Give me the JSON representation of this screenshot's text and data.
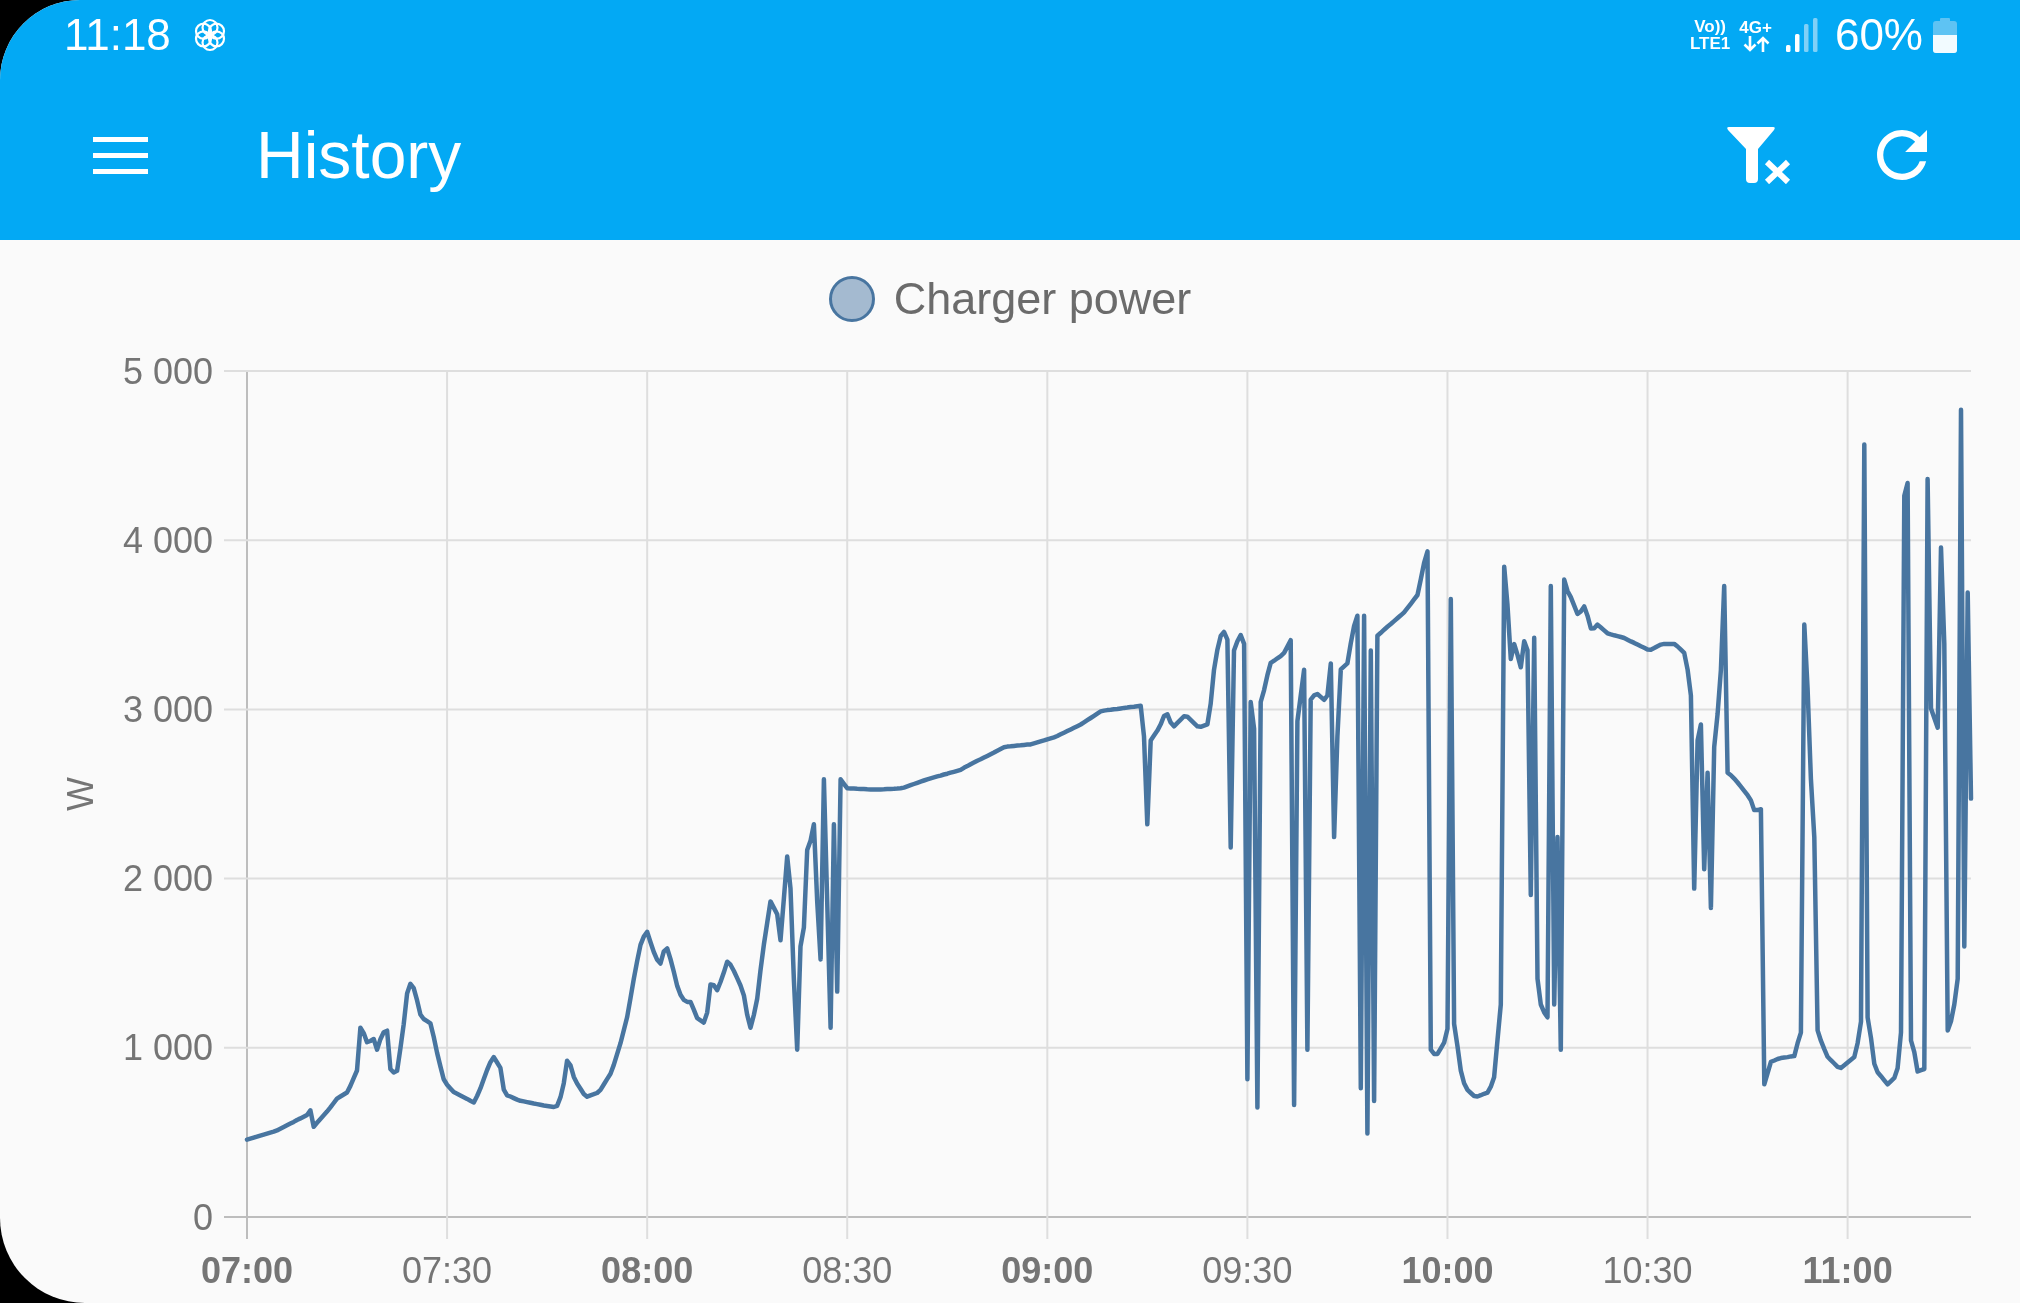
{
  "status_bar": {
    "time": "11:18",
    "volte": {
      "top": "Vo))",
      "bottom": "LTE1"
    },
    "network_type": "4G+",
    "battery_percent": "60%"
  },
  "app_bar": {
    "title": "History"
  },
  "chart": {
    "chart_data": {
      "type": "line",
      "ylabel": "W",
      "grid": true,
      "categories": [
        "07:00",
        null,
        null,
        null,
        null,
        null,
        null,
        null,
        null,
        null,
        null,
        null,
        null,
        null,
        null,
        null,
        null,
        null,
        null,
        null,
        null,
        null,
        null,
        null,
        null,
        null,
        null,
        null,
        null,
        null,
        null,
        null,
        null,
        null,
        null,
        null,
        null,
        null,
        null,
        null,
        null,
        null,
        null,
        null,
        null,
        null,
        null,
        null,
        null,
        null,
        null,
        null,
        null,
        null,
        null,
        null,
        null,
        null,
        null,
        null,
        "07:30",
        null,
        null,
        null,
        null,
        null,
        null,
        null,
        null,
        null,
        null,
        null,
        null,
        null,
        null,
        null,
        null,
        null,
        null,
        null,
        null,
        null,
        null,
        null,
        null,
        null,
        null,
        null,
        null,
        null,
        null,
        null,
        null,
        null,
        null,
        null,
        null,
        null,
        null,
        null,
        null,
        null,
        null,
        null,
        null,
        null,
        null,
        null,
        null,
        null,
        null,
        null,
        null,
        null,
        null,
        null,
        null,
        null,
        null,
        null,
        "08:00",
        null,
        null,
        null,
        null,
        null,
        null,
        null,
        null,
        null,
        null,
        null,
        null,
        null,
        null,
        null,
        null,
        null,
        null,
        null,
        null,
        null,
        null,
        null,
        null,
        null,
        null,
        null,
        null,
        null,
        null,
        null,
        null,
        null,
        null,
        null,
        null,
        null,
        null,
        null,
        null,
        null,
        null,
        null,
        null,
        null,
        null,
        null,
        null,
        null,
        null,
        null,
        null,
        null,
        null,
        null,
        null,
        null,
        null,
        null,
        "08:30",
        null,
        null,
        null,
        null,
        null,
        null,
        null,
        null,
        null,
        null,
        null,
        null,
        null,
        null,
        null,
        null,
        null,
        null,
        null,
        null,
        null,
        null,
        null,
        null,
        null,
        null,
        null,
        null,
        null,
        null,
        null,
        null,
        null,
        null,
        null,
        null,
        null,
        null,
        null,
        null,
        null,
        null,
        null,
        null,
        null,
        null,
        null,
        null,
        null,
        null,
        null,
        null,
        null,
        null,
        null,
        null,
        null,
        null,
        null,
        "09:00",
        null,
        null,
        null,
        null,
        null,
        null,
        null,
        null,
        null,
        null,
        null,
        null,
        null,
        null,
        null,
        null,
        null,
        null,
        null,
        null,
        null,
        null,
        null,
        null,
        null,
        null,
        null,
        null,
        null,
        null,
        null,
        null,
        null,
        null,
        null,
        null,
        null,
        null,
        null,
        null,
        null,
        null,
        null,
        null,
        null,
        null,
        null,
        null,
        null,
        null,
        null,
        null,
        null,
        null,
        null,
        null,
        null,
        null,
        null,
        "09:30",
        null,
        null,
        null,
        null,
        null,
        null,
        null,
        null,
        null,
        null,
        null,
        null,
        null,
        null,
        null,
        null,
        null,
        null,
        null,
        null,
        null,
        null,
        null,
        null,
        null,
        null,
        null,
        null,
        null,
        null,
        null,
        null,
        null,
        null,
        null,
        null,
        null,
        null,
        null,
        null,
        null,
        null,
        null,
        null,
        null,
        null,
        null,
        null,
        null,
        null,
        null,
        null,
        null,
        null,
        null,
        null,
        null,
        null,
        null,
        "10:00",
        null,
        null,
        null,
        null,
        null,
        null,
        null,
        null,
        null,
        null,
        null,
        null,
        null,
        null,
        null,
        null,
        null,
        null,
        null,
        null,
        null,
        null,
        null,
        null,
        null,
        null,
        null,
        null,
        null,
        null,
        null,
        null,
        null,
        null,
        null,
        null,
        null,
        null,
        null,
        null,
        null,
        null,
        null,
        null,
        null,
        null,
        null,
        null,
        null,
        null,
        null,
        null,
        null,
        null,
        null,
        null,
        null,
        null,
        null,
        "10:30",
        null,
        null,
        null,
        null,
        null,
        null,
        null,
        null,
        null,
        null,
        null,
        null,
        null,
        null,
        null,
        null,
        null,
        null,
        null,
        null,
        null,
        null,
        null,
        null,
        null,
        null,
        null,
        null,
        null,
        null,
        null,
        null,
        null,
        null,
        null,
        null,
        null,
        null,
        null,
        null,
        null,
        null,
        null,
        null,
        null,
        null,
        null,
        null,
        null,
        null,
        null,
        null,
        null,
        null,
        null,
        null,
        null,
        null,
        null,
        "11:00",
        null,
        null,
        null,
        null,
        null,
        null,
        null,
        null,
        null,
        null,
        null,
        null,
        null,
        null,
        null,
        null,
        null,
        null,
        null,
        null,
        null,
        null,
        null,
        null,
        null,
        null,
        null,
        null,
        null,
        null,
        null,
        null,
        null,
        null,
        null,
        null,
        null
      ],
      "series": [
        {
          "name": "Charger power",
          "color": "#4875a0",
          "values": [
            457,
            463,
            469,
            475,
            481,
            487,
            493,
            499,
            505,
            512,
            522,
            532,
            542,
            552,
            562,
            573,
            583,
            593,
            603,
            630,
            533,
            557,
            580,
            601,
            623,
            648,
            674,
            700,
            712,
            724,
            736,
            775,
            821,
            866,
            1119,
            1087,
            1033,
            1040,
            1052,
            989,
            1051,
            1092,
            1101,
            875,
            854,
            864,
            997,
            1139,
            1321,
            1378,
            1352,
            1280,
            1197,
            1170,
            1157,
            1144,
            1065,
            970,
            890,
            814,
            782,
            760,
            738,
            728,
            718,
            708,
            698,
            687,
            677,
            715,
            760,
            816,
            869,
            915,
            945,
            913,
            881,
            753,
            719,
            712,
            703,
            694,
            687,
            683,
            679,
            675,
            671,
            667,
            663,
            659,
            656,
            653,
            650,
            657,
            708,
            791,
            924,
            896,
            828,
            789,
            758,
            727,
            711,
            719,
            726,
            733,
            751,
            783,
            815,
            847,
            899,
            962,
            1027,
            1104,
            1180,
            1294,
            1408,
            1514,
            1608,
            1657,
            1685,
            1624,
            1566,
            1520,
            1498,
            1570,
            1587,
            1524,
            1450,
            1366,
            1314,
            1283,
            1271,
            1271,
            1226,
            1175,
            1162,
            1149,
            1208,
            1375,
            1370,
            1341,
            1389,
            1446,
            1509,
            1491,
            1454,
            1412,
            1368,
            1309,
            1195,
            1118,
            1195,
            1290,
            1458,
            1611,
            1738,
            1865,
            1827,
            1789,
            1636,
            1884,
            2131,
            1941,
            1400,
            989,
            1600,
            1712,
            2169,
            2226,
            2321,
            1865,
            1522,
            2587,
            1865,
            1119,
            2321,
            1332,
            2587,
            2560,
            2534,
            2533,
            2532,
            2531,
            2530,
            2529,
            2528,
            2527,
            2526,
            2526,
            2527,
            2528,
            2529,
            2530,
            2531,
            2532,
            2534,
            2538,
            2545,
            2552,
            2559,
            2566,
            2573,
            2580,
            2587,
            2593,
            2598,
            2604,
            2609,
            2615,
            2620,
            2626,
            2631,
            2637,
            2643,
            2655,
            2665,
            2676,
            2686,
            2697,
            2705,
            2715,
            2725,
            2735,
            2745,
            2756,
            2766,
            2776,
            2780,
            2782,
            2784,
            2786,
            2788,
            2790,
            2792,
            2793,
            2799,
            2805,
            2811,
            2817,
            2823,
            2829,
            2835,
            2843,
            2853,
            2862,
            2872,
            2882,
            2891,
            2901,
            2911,
            2923,
            2936,
            2949,
            2962,
            2975,
            2988,
            2993,
            2996,
            2998,
            3001,
            3003,
            3006,
            3009,
            3011,
            3014,
            3016,
            3019,
            3021,
            2839,
            2321,
            2816,
            2845,
            2875,
            2912,
            2961,
            2971,
            2922,
            2900,
            2920,
            2940,
            2960,
            2957,
            2938,
            2919,
            2900,
            2897,
            2904,
            2912,
            3034,
            3234,
            3353,
            3434,
            3458,
            3412,
            2184,
            3348,
            3403,
            3440,
            3387,
            814,
            3044,
            2886,
            647,
            3044,
            3114,
            3202,
            3275,
            3288,
            3302,
            3315,
            3334,
            3371,
            3409,
            662,
            2930,
            3080,
            3234,
            989,
            3058,
            3083,
            3091,
            3074,
            3057,
            3082,
            3272,
            2245,
            2840,
            3237,
            3255,
            3272,
            3391,
            3493,
            3554,
            761,
            3554,
            494,
            3348,
            685,
            3435,
            3453,
            3471,
            3488,
            3505,
            3522,
            3539,
            3556,
            3574,
            3598,
            3624,
            3650,
            3676,
            3769,
            3866,
            3934,
            989,
            964,
            964,
            997,
            1030,
            1112,
            3653,
            1141,
            1008,
            865,
            790,
            751,
            733,
            715,
            712,
            720,
            728,
            735,
            770,
            826,
            1046,
            1256,
            3843,
            3615,
            3297,
            3386,
            3322,
            3249,
            3403,
            3349,
            1903,
            3424,
            1408,
            1256,
            1209,
            1180,
            3729,
            1256,
            2245,
            989,
            3767,
            3700,
            3664,
            3613,
            3564,
            3579,
            3609,
            3554,
            3478,
            3480,
            3501,
            3484,
            3467,
            3450,
            3443,
            3438,
            3433,
            3428,
            3422,
            3412,
            3402,
            3393,
            3383,
            3373,
            3364,
            3354,
            3352,
            3362,
            3373,
            3383,
            3387,
            3387,
            3387,
            3387,
            3372,
            3353,
            3334,
            3235,
            3082,
            1941,
            2816,
            2911,
            2055,
            2626,
            1827,
            2778,
            2974,
            3234,
            3729,
            2626,
            2611,
            2591,
            2568,
            2544,
            2519,
            2493,
            2462,
            2405,
            2405,
            2410,
            784,
            850,
            917,
            925,
            934,
            939,
            942,
            945,
            949,
            951,
            1027,
            1090,
            3501,
            3120,
            2590,
            2245,
            1103,
            1042,
            992,
            947,
            927,
            907,
            887,
            881,
            897,
            913,
            929,
            945,
            1027,
            1155,
            4566,
            1180,
            1058,
            906,
            856,
            832,
            808,
            784,
            803,
            822,
            879,
            1091,
            4262,
            4338,
            1043,
            974,
            860,
            868,
            875,
            4361,
            3006,
            2950,
            2892,
            3957,
            3387,
            1103,
            1157,
            1256,
            1408,
            4771,
            1598,
            3691,
            2473
          ]
        }
      ],
      "ylim": [
        0,
        5000
      ],
      "yticks": [
        {
          "value": 0,
          "label": "0"
        },
        {
          "value": 1000,
          "label": "1 000"
        },
        {
          "value": 2000,
          "label": "2 000"
        },
        {
          "value": 3000,
          "label": "3 000"
        },
        {
          "value": 4000,
          "label": "4 000"
        },
        {
          "value": 5000,
          "label": "5 000"
        }
      ]
    }
  }
}
